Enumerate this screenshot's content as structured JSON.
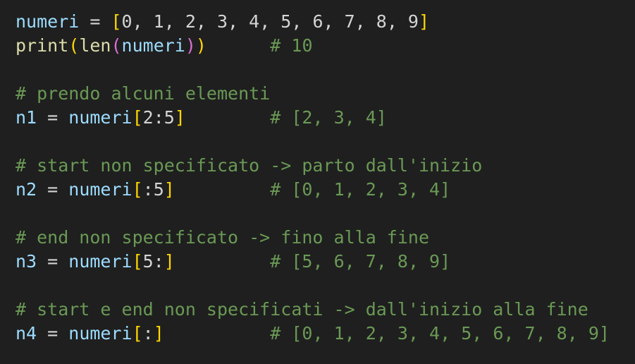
{
  "editor": {
    "lines": [
      [
        {
          "t": "numeri",
          "c": "var"
        },
        {
          "t": " = ",
          "c": "op"
        },
        {
          "t": "[",
          "c": "br1"
        },
        {
          "t": "0, 1, 2, 3, 4, 5, 6, 7, 8, 9",
          "c": "plain"
        },
        {
          "t": "]",
          "c": "br1"
        }
      ],
      [
        {
          "t": "print",
          "c": "fn"
        },
        {
          "t": "(",
          "c": "br1"
        },
        {
          "t": "len",
          "c": "fn"
        },
        {
          "t": "(",
          "c": "br2"
        },
        {
          "t": "numeri",
          "c": "var"
        },
        {
          "t": ")",
          "c": "br2"
        },
        {
          "t": ")",
          "c": "br1"
        },
        {
          "t": "      ",
          "c": "plain"
        },
        {
          "t": "# 10",
          "c": "com"
        }
      ],
      [],
      [
        {
          "t": "# prendo alcuni elementi",
          "c": "com"
        }
      ],
      [
        {
          "t": "n1",
          "c": "var"
        },
        {
          "t": " = ",
          "c": "op"
        },
        {
          "t": "numeri",
          "c": "var"
        },
        {
          "t": "[",
          "c": "br1"
        },
        {
          "t": "2:5",
          "c": "plain"
        },
        {
          "t": "]",
          "c": "br1"
        },
        {
          "t": "        ",
          "c": "plain"
        },
        {
          "t": "# [2, 3, 4]",
          "c": "com"
        }
      ],
      [],
      [
        {
          "t": "# start non specificato -> parto dall'inizio",
          "c": "com"
        }
      ],
      [
        {
          "t": "n2",
          "c": "var"
        },
        {
          "t": " = ",
          "c": "op"
        },
        {
          "t": "numeri",
          "c": "var"
        },
        {
          "t": "[",
          "c": "br1"
        },
        {
          "t": ":5",
          "c": "plain"
        },
        {
          "t": "]",
          "c": "br1"
        },
        {
          "t": "         ",
          "c": "plain"
        },
        {
          "t": "# [0, 1, 2, 3, 4]",
          "c": "com"
        }
      ],
      [],
      [
        {
          "t": "# end non specificato -> fino alla fine",
          "c": "com"
        }
      ],
      [
        {
          "t": "n3",
          "c": "var"
        },
        {
          "t": " = ",
          "c": "op"
        },
        {
          "t": "numeri",
          "c": "var"
        },
        {
          "t": "[",
          "c": "br1"
        },
        {
          "t": "5:",
          "c": "plain"
        },
        {
          "t": "]",
          "c": "br1"
        },
        {
          "t": "         ",
          "c": "plain"
        },
        {
          "t": "# [5, 6, 7, 8, 9]",
          "c": "com"
        }
      ],
      [],
      [
        {
          "t": "# start e end non specificati -> dall'inizio alla fine",
          "c": "com"
        }
      ],
      [
        {
          "t": "n4",
          "c": "var"
        },
        {
          "t": " = ",
          "c": "op"
        },
        {
          "t": "numeri",
          "c": "var"
        },
        {
          "t": "[",
          "c": "br1"
        },
        {
          "t": ":",
          "c": "plain"
        },
        {
          "t": "]",
          "c": "br1"
        },
        {
          "t": "          ",
          "c": "plain"
        },
        {
          "t": "# [0, 1, 2, 3, 4, 5, 6, 7, 8, 9]",
          "c": "com"
        }
      ]
    ]
  },
  "colors": {
    "background": "#1f1f1f",
    "variable": "#9cdcfe",
    "function": "#dcdcaa",
    "comment": "#6a9955",
    "bracket_level1": "#ffd700",
    "bracket_level2": "#da70d6",
    "default_text": "#d4d4d4"
  }
}
